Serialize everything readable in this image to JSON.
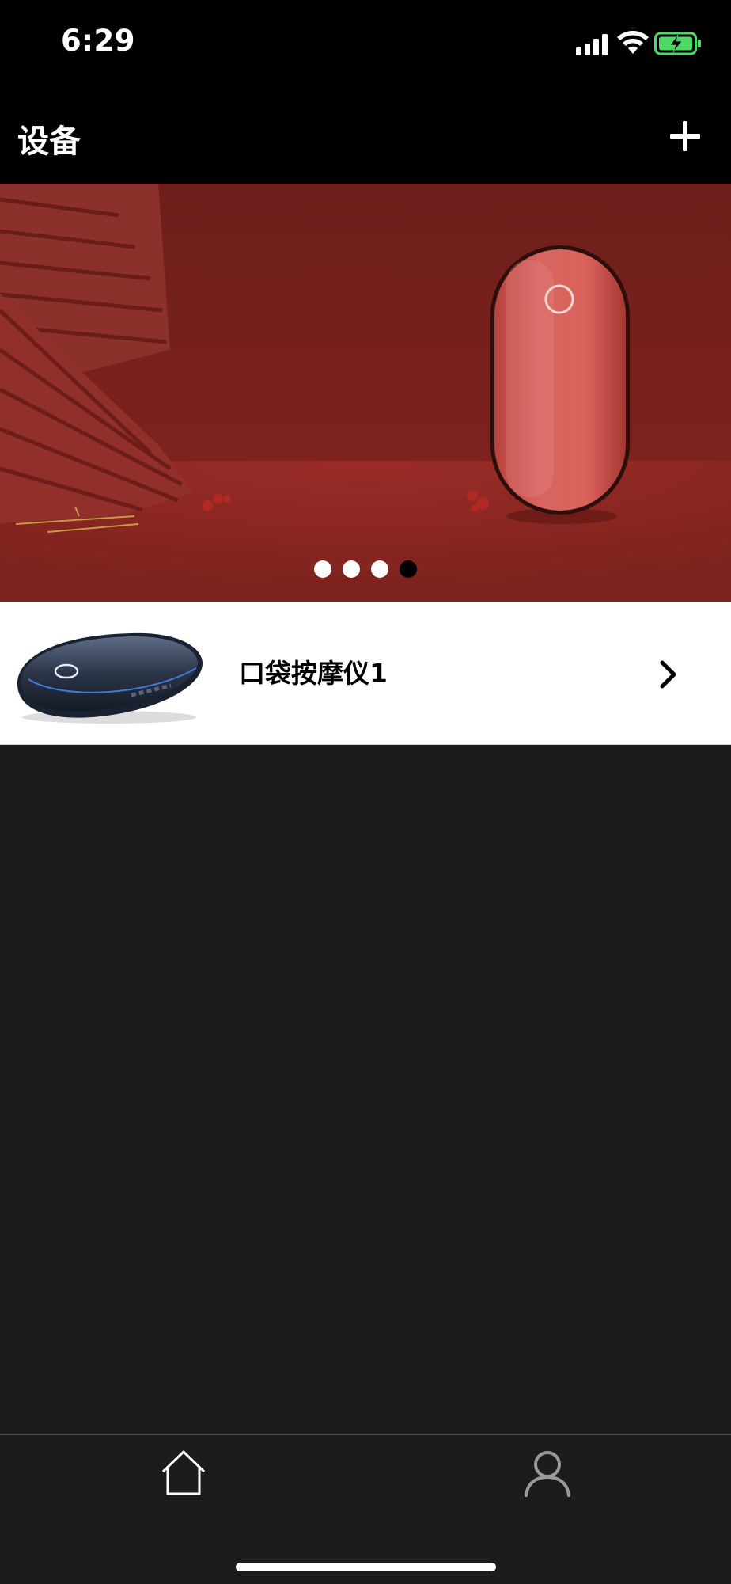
{
  "status_bar": {
    "time": "6:29",
    "icons": [
      "cellular-signal-icon",
      "wifi-icon",
      "battery-charging-icon"
    ],
    "battery_color": "#4cd964"
  },
  "header": {
    "title": "设备",
    "add_icon": "plus-icon"
  },
  "banner": {
    "slide_count": 4,
    "active_slide_index": 3,
    "background_color": "#8a2420"
  },
  "devices": [
    {
      "name": "口袋按摩仪1",
      "chevron_icon": "chevron-right-icon"
    }
  ],
  "tab_bar": {
    "tabs": [
      {
        "icon": "home-icon",
        "active": true
      },
      {
        "icon": "user-icon",
        "active": false
      }
    ]
  },
  "colors": {
    "nav_background": "#000000",
    "page_background": "#1c1c1c",
    "list_background": "#ffffff"
  }
}
